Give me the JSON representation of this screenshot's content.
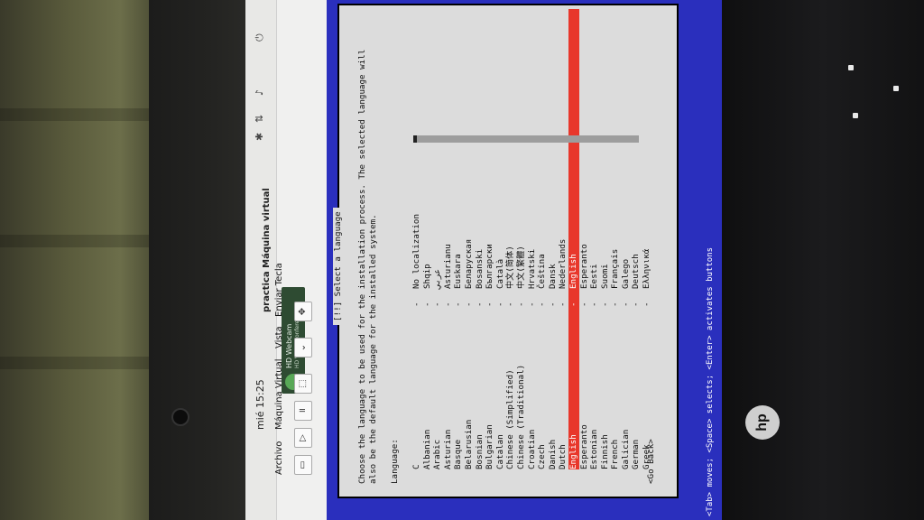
{
  "taskbar": {
    "clock": "mié 15:25"
  },
  "webcam_notification": {
    "title": "HD Webcam",
    "subtitle": "HD Video Conferencing"
  },
  "window": {
    "title": "practica Máquina virtual"
  },
  "menu": {
    "items": [
      "Archivo",
      "Máquina Virtual",
      "Vista",
      "Enviar Tecla"
    ]
  },
  "installer": {
    "dialog_title": "[!!] Select a language",
    "intro_line1": "Choose the language to be used for the installation process. The selected language will",
    "intro_line2": "also be the default language for the installed system.",
    "language_label": "Language:",
    "languages": [
      {
        "en": "C",
        "native": "No localization"
      },
      {
        "en": "Albanian",
        "native": "Shqip"
      },
      {
        "en": "Arabic",
        "native": "عربي"
      },
      {
        "en": "Asturian",
        "native": "Asturianu"
      },
      {
        "en": "Basque",
        "native": "Euskara"
      },
      {
        "en": "Belarusian",
        "native": "Беларуская"
      },
      {
        "en": "Bosnian",
        "native": "Bosanski"
      },
      {
        "en": "Bulgarian",
        "native": "Български"
      },
      {
        "en": "Catalan",
        "native": "Català"
      },
      {
        "en": "Chinese (Simplified)",
        "native": "中文(简体)"
      },
      {
        "en": "Chinese (Traditional)",
        "native": "中文(繁體)"
      },
      {
        "en": "Croatian",
        "native": "Hrvatski"
      },
      {
        "en": "Czech",
        "native": "Čeština"
      },
      {
        "en": "Danish",
        "native": "Dansk"
      },
      {
        "en": "Dutch",
        "native": "Nederlands"
      },
      {
        "en": "English",
        "native": "English"
      },
      {
        "en": "Esperanto",
        "native": "Esperanto"
      },
      {
        "en": "Estonian",
        "native": "Eesti"
      },
      {
        "en": "Finnish",
        "native": "Suomi"
      },
      {
        "en": "French",
        "native": "Français"
      },
      {
        "en": "Galician",
        "native": "Galego"
      },
      {
        "en": "German",
        "native": "Deutsch"
      },
      {
        "en": "Greek",
        "native": "Ελληνικά"
      }
    ],
    "selected_index": 15,
    "go_back": "<Go Back>",
    "hint": "<Tab> moves; <Space> selects; <Enter> activates buttons"
  },
  "colors": {
    "vm_background": "#2a2fbd",
    "selection": "#e8372b"
  },
  "laptop": {
    "logo": "hp"
  }
}
